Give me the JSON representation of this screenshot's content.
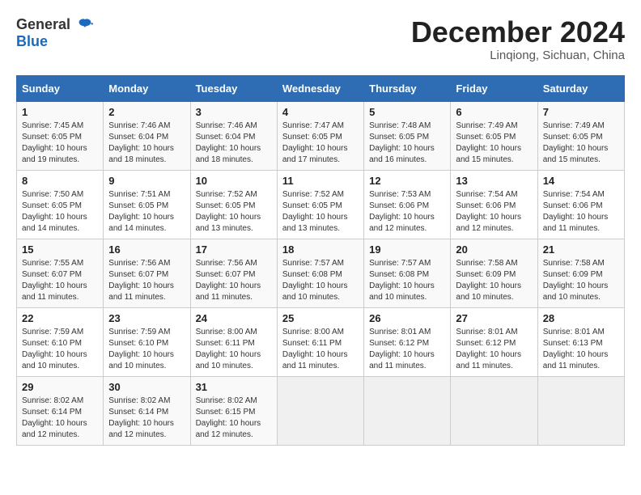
{
  "logo": {
    "general": "General",
    "blue": "Blue"
  },
  "title": "December 2024",
  "location": "Linqiong, Sichuan, China",
  "days_of_week": [
    "Sunday",
    "Monday",
    "Tuesday",
    "Wednesday",
    "Thursday",
    "Friday",
    "Saturday"
  ],
  "weeks": [
    [
      {
        "day": "1",
        "sunrise": "7:45 AM",
        "sunset": "6:05 PM",
        "daylight": "10 hours and 19 minutes."
      },
      {
        "day": "2",
        "sunrise": "7:46 AM",
        "sunset": "6:04 PM",
        "daylight": "10 hours and 18 minutes."
      },
      {
        "day": "3",
        "sunrise": "7:46 AM",
        "sunset": "6:04 PM",
        "daylight": "10 hours and 18 minutes."
      },
      {
        "day": "4",
        "sunrise": "7:47 AM",
        "sunset": "6:05 PM",
        "daylight": "10 hours and 17 minutes."
      },
      {
        "day": "5",
        "sunrise": "7:48 AM",
        "sunset": "6:05 PM",
        "daylight": "10 hours and 16 minutes."
      },
      {
        "day": "6",
        "sunrise": "7:49 AM",
        "sunset": "6:05 PM",
        "daylight": "10 hours and 15 minutes."
      },
      {
        "day": "7",
        "sunrise": "7:49 AM",
        "sunset": "6:05 PM",
        "daylight": "10 hours and 15 minutes."
      }
    ],
    [
      {
        "day": "8",
        "sunrise": "7:50 AM",
        "sunset": "6:05 PM",
        "daylight": "10 hours and 14 minutes."
      },
      {
        "day": "9",
        "sunrise": "7:51 AM",
        "sunset": "6:05 PM",
        "daylight": "10 hours and 14 minutes."
      },
      {
        "day": "10",
        "sunrise": "7:52 AM",
        "sunset": "6:05 PM",
        "daylight": "10 hours and 13 minutes."
      },
      {
        "day": "11",
        "sunrise": "7:52 AM",
        "sunset": "6:05 PM",
        "daylight": "10 hours and 13 minutes."
      },
      {
        "day": "12",
        "sunrise": "7:53 AM",
        "sunset": "6:06 PM",
        "daylight": "10 hours and 12 minutes."
      },
      {
        "day": "13",
        "sunrise": "7:54 AM",
        "sunset": "6:06 PM",
        "daylight": "10 hours and 12 minutes."
      },
      {
        "day": "14",
        "sunrise": "7:54 AM",
        "sunset": "6:06 PM",
        "daylight": "10 hours and 11 minutes."
      }
    ],
    [
      {
        "day": "15",
        "sunrise": "7:55 AM",
        "sunset": "6:07 PM",
        "daylight": "10 hours and 11 minutes."
      },
      {
        "day": "16",
        "sunrise": "7:56 AM",
        "sunset": "6:07 PM",
        "daylight": "10 hours and 11 minutes."
      },
      {
        "day": "17",
        "sunrise": "7:56 AM",
        "sunset": "6:07 PM",
        "daylight": "10 hours and 11 minutes."
      },
      {
        "day": "18",
        "sunrise": "7:57 AM",
        "sunset": "6:08 PM",
        "daylight": "10 hours and 10 minutes."
      },
      {
        "day": "19",
        "sunrise": "7:57 AM",
        "sunset": "6:08 PM",
        "daylight": "10 hours and 10 minutes."
      },
      {
        "day": "20",
        "sunrise": "7:58 AM",
        "sunset": "6:09 PM",
        "daylight": "10 hours and 10 minutes."
      },
      {
        "day": "21",
        "sunrise": "7:58 AM",
        "sunset": "6:09 PM",
        "daylight": "10 hours and 10 minutes."
      }
    ],
    [
      {
        "day": "22",
        "sunrise": "7:59 AM",
        "sunset": "6:10 PM",
        "daylight": "10 hours and 10 minutes."
      },
      {
        "day": "23",
        "sunrise": "7:59 AM",
        "sunset": "6:10 PM",
        "daylight": "10 hours and 10 minutes."
      },
      {
        "day": "24",
        "sunrise": "8:00 AM",
        "sunset": "6:11 PM",
        "daylight": "10 hours and 10 minutes."
      },
      {
        "day": "25",
        "sunrise": "8:00 AM",
        "sunset": "6:11 PM",
        "daylight": "10 hours and 11 minutes."
      },
      {
        "day": "26",
        "sunrise": "8:01 AM",
        "sunset": "6:12 PM",
        "daylight": "10 hours and 11 minutes."
      },
      {
        "day": "27",
        "sunrise": "8:01 AM",
        "sunset": "6:12 PM",
        "daylight": "10 hours and 11 minutes."
      },
      {
        "day": "28",
        "sunrise": "8:01 AM",
        "sunset": "6:13 PM",
        "daylight": "10 hours and 11 minutes."
      }
    ],
    [
      {
        "day": "29",
        "sunrise": "8:02 AM",
        "sunset": "6:14 PM",
        "daylight": "10 hours and 12 minutes."
      },
      {
        "day": "30",
        "sunrise": "8:02 AM",
        "sunset": "6:14 PM",
        "daylight": "10 hours and 12 minutes."
      },
      {
        "day": "31",
        "sunrise": "8:02 AM",
        "sunset": "6:15 PM",
        "daylight": "10 hours and 12 minutes."
      },
      null,
      null,
      null,
      null
    ]
  ]
}
